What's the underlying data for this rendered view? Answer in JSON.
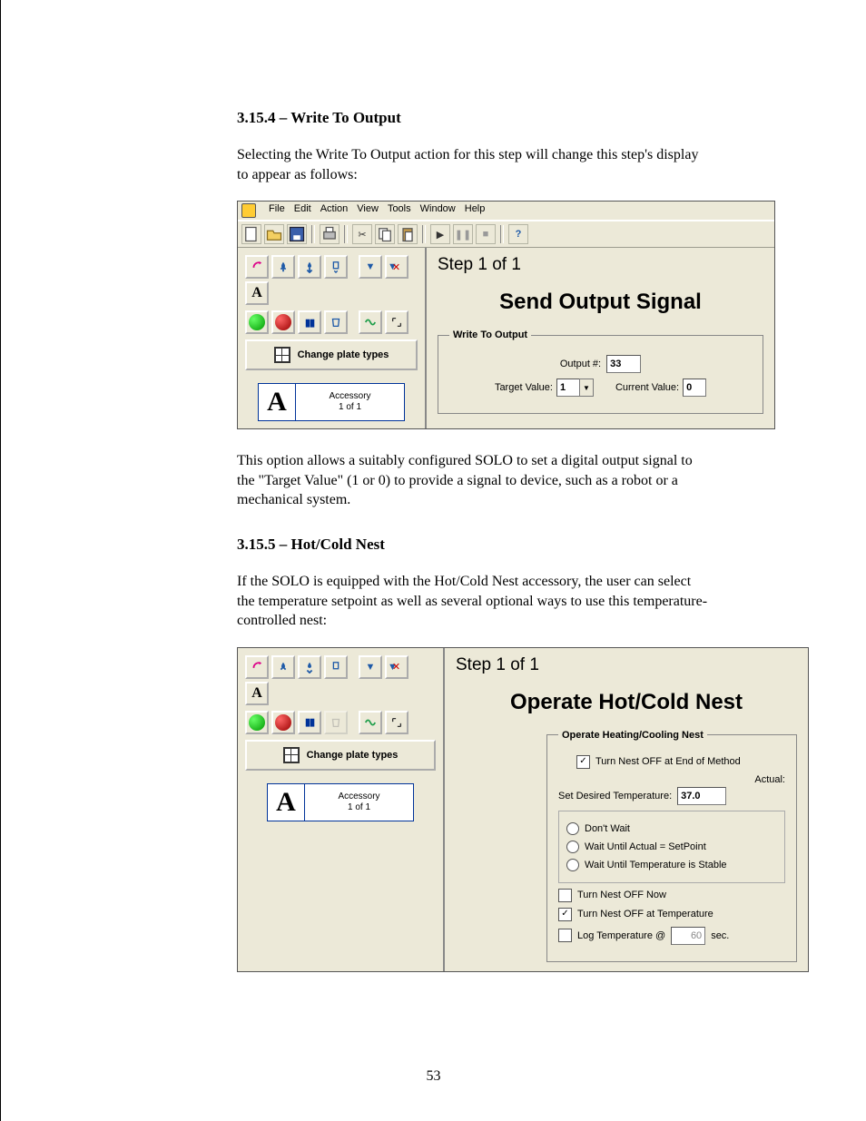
{
  "page_number": "53",
  "section1": {
    "heading": "3.15.4 – Write To Output",
    "para1": "Selecting the Write To Output action for this step will change this step's display to appear as follows:",
    "para2": "This option allows a suitably configured SOLO to set a digital output signal to the \"Target Value\" (1 or 0) to provide a signal to device, such as a robot or a mechanical system."
  },
  "section2": {
    "heading": "3.15.5 – Hot/Cold Nest",
    "para1": "If the SOLO is equipped with the Hot/Cold Nest accessory, the user can select the temperature setpoint as well as several optional ways to use this temperature-controlled nest:"
  },
  "shot1": {
    "menus": [
      "File",
      "Edit",
      "Action",
      "View",
      "Tools",
      "Window",
      "Help"
    ],
    "change_plate_types": "Change plate types",
    "accessory": {
      "letter": "A",
      "label_line1": "Accessory",
      "label_line2": "1 of 1"
    },
    "step_label": "Step 1 of 1",
    "title": "Send Output Signal",
    "group_legend": "Write To Output",
    "output_num_label": "Output #:",
    "output_num_value": "33",
    "target_label": "Target Value:",
    "target_value": "1",
    "current_label": "Current Value:",
    "current_value": "0"
  },
  "shot2": {
    "change_plate_types": "Change plate types",
    "accessory": {
      "letter": "A",
      "label_line1": "Accessory",
      "label_line2": "1 of 1"
    },
    "step_label": "Step 1 of 1",
    "title": "Operate Hot/Cold Nest",
    "group_legend": "Operate Heating/Cooling Nest",
    "turn_off_end": "Turn Nest OFF at End of Method",
    "turn_off_end_checked": true,
    "actual_label": "Actual:",
    "set_temp_label": "Set Desired Temperature:",
    "set_temp_value": "37.0",
    "radio1": "Don't Wait",
    "radio2": "Wait Until Actual = SetPoint",
    "radio3": "Wait Until Temperature is Stable",
    "turn_off_now": "Turn Nest OFF Now",
    "turn_off_now_checked": false,
    "turn_off_at_temp": "Turn Nest OFF at Temperature",
    "turn_off_at_temp_checked": true,
    "log_temp_label": "Log Temperature @",
    "log_temp_checked": false,
    "log_temp_value": "60",
    "log_temp_unit": "sec."
  }
}
